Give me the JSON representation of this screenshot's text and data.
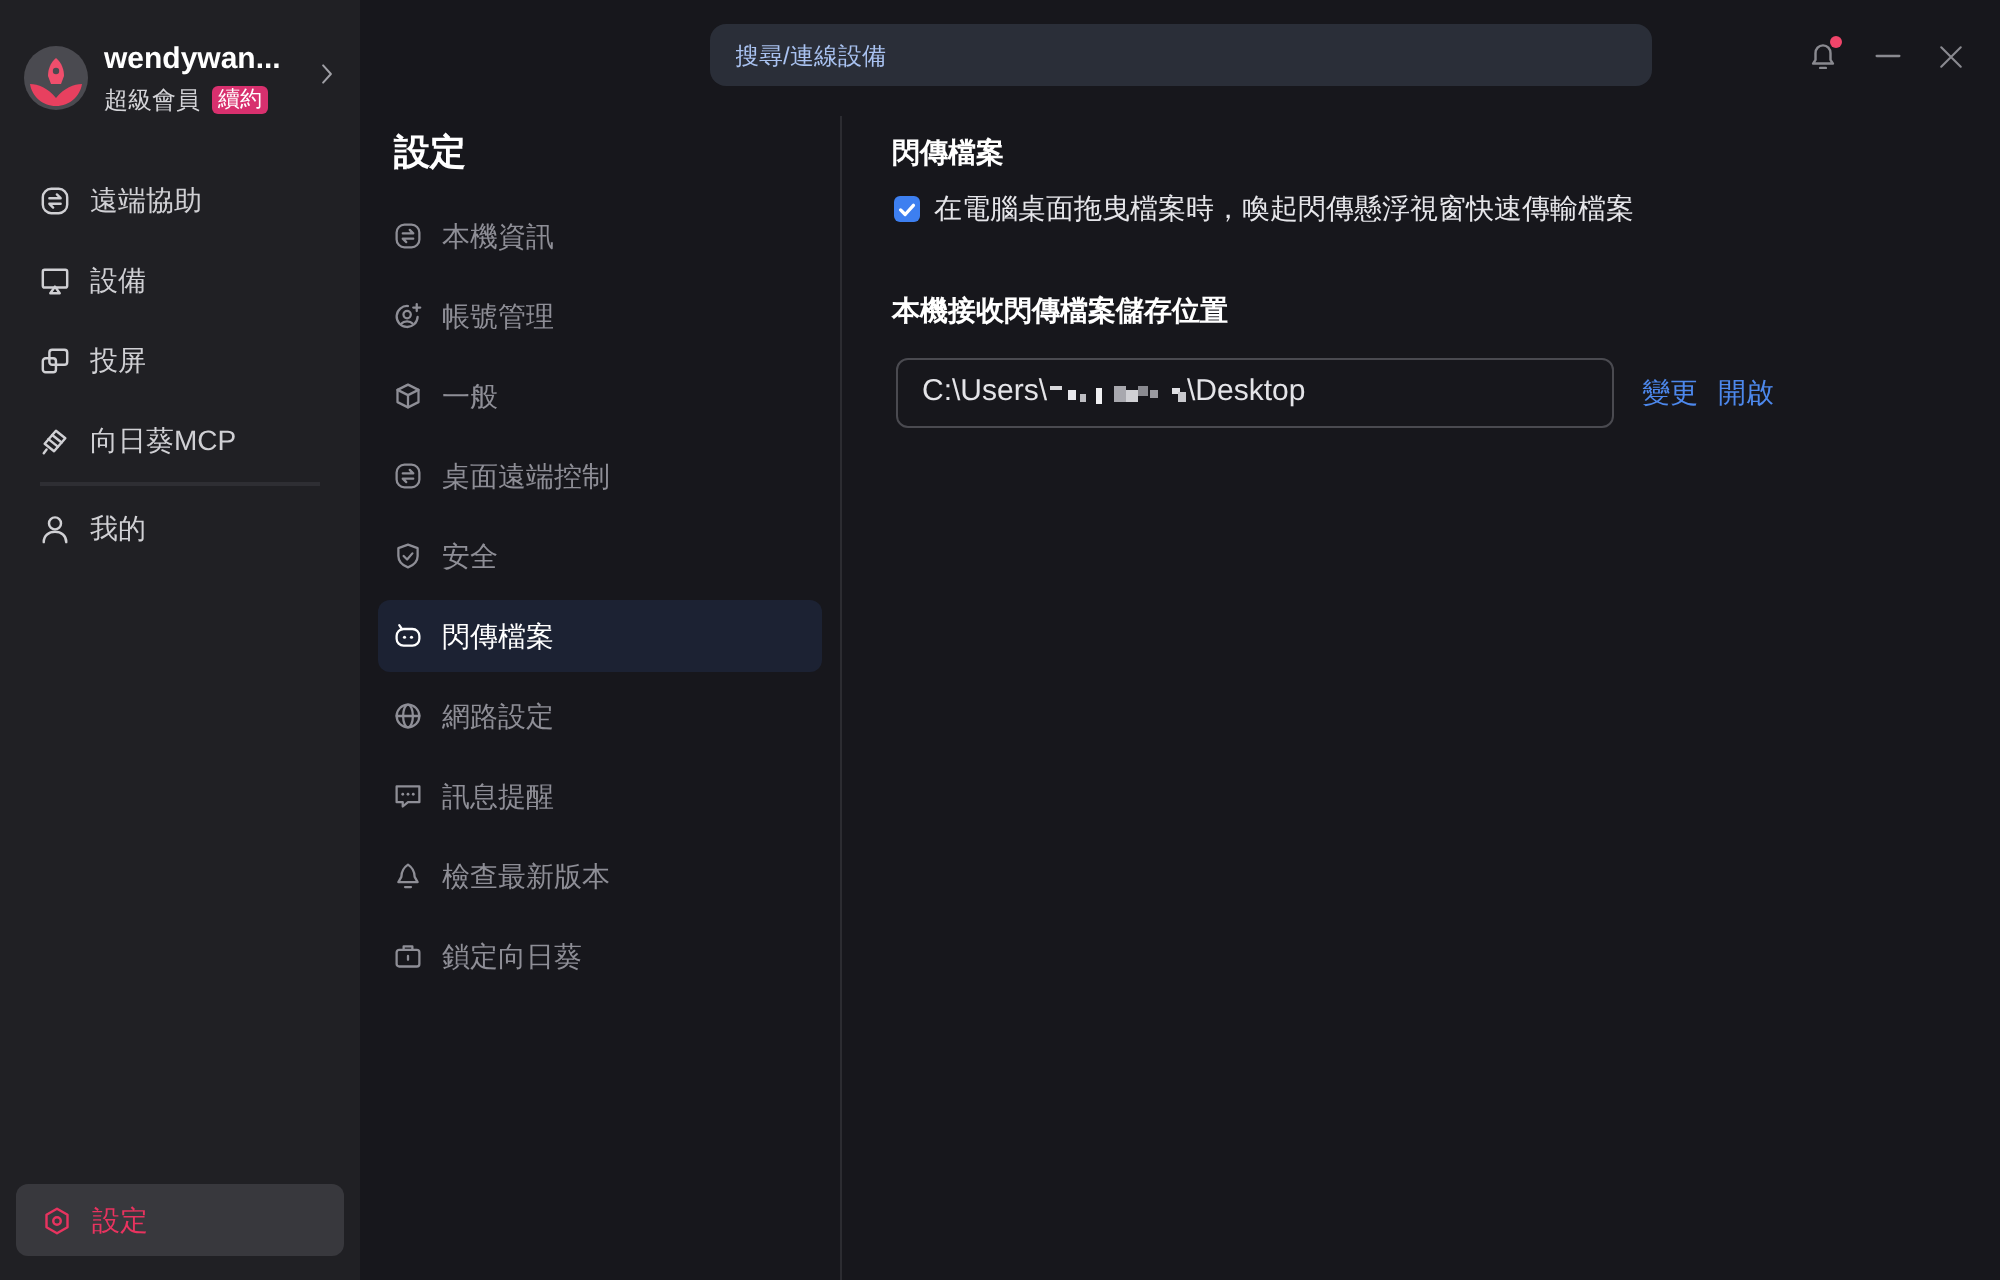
{
  "user": {
    "name": "wendywan...",
    "tier": "超級會員",
    "badge": "續約"
  },
  "nav_groups": [
    [
      {
        "label": "遠端協助",
        "selected": false
      },
      {
        "label": "設備",
        "selected": false
      },
      {
        "label": "投屏",
        "selected": false
      },
      {
        "label": "向日葵MCP",
        "selected": false
      }
    ],
    [
      {
        "label": "我的",
        "selected": false
      }
    ]
  ],
  "settings_button": {
    "label": "設定",
    "selected": true
  },
  "search": {
    "placeholder": "搜尋/連線設備"
  },
  "notifications": {
    "unread": true
  },
  "settings_menu": {
    "title": "設定",
    "items": [
      {
        "label": "本機資訊",
        "selected": false
      },
      {
        "label": "帳號管理",
        "selected": false
      },
      {
        "label": "一般",
        "selected": false
      },
      {
        "label": "桌面遠端控制",
        "selected": false
      },
      {
        "label": "安全",
        "selected": false
      },
      {
        "label": "閃傳檔案",
        "selected": true
      },
      {
        "label": "網路設定",
        "selected": false
      },
      {
        "label": "訊息提醒",
        "selected": false
      },
      {
        "label": "檢查最新版本",
        "selected": false
      },
      {
        "label": "鎖定向日葵",
        "selected": false
      }
    ]
  },
  "panel": {
    "title": "閃傳檔案",
    "option": {
      "label": "在電腦桌面拖曳檔案時，喚起閃傳懸浮視窗快速傳輸檔案",
      "checked": true
    },
    "location_title": "本機接收閃傳檔案儲存位置",
    "path": {
      "value_start": "C:\\Users\\",
      "value_end": "\\Desktop",
      "redacted": true
    },
    "actions": [
      "變更",
      "開啟"
    ]
  }
}
